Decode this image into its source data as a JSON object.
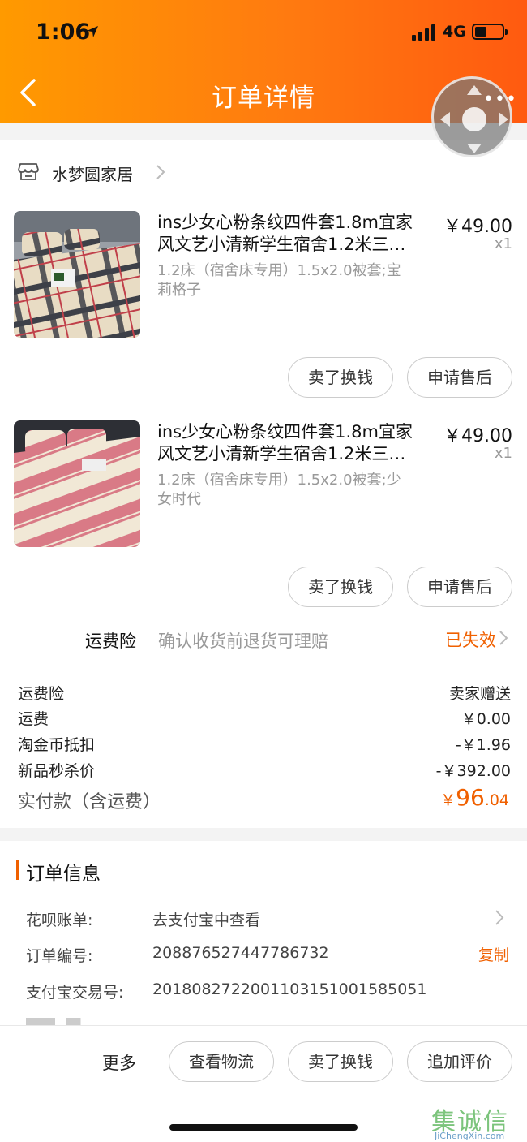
{
  "status_bar": {
    "time": "1:06",
    "network": "4G"
  },
  "nav": {
    "title": "订单详情",
    "more": "•••"
  },
  "shop": {
    "name": "水梦圆家居"
  },
  "items": [
    {
      "title_line1": "ins少女心粉条纹四件套1.8m宜家",
      "title_line2": "风文艺小清新学生宿舍1.2米三…",
      "sku_line1": "1.2床（宿舍床专用）1.5x2.0被套;宝",
      "sku_line2": "莉格子",
      "price": "￥49.00",
      "qty": "x1",
      "btn_sell": "卖了换钱",
      "btn_service": "申请售后"
    },
    {
      "title_line1": "ins少女心粉条纹四件套1.8m宜家",
      "title_line2": "风文艺小清新学生宿舍1.2米三…",
      "sku_line1": "1.2床（宿舍床专用）1.5x2.0被套;少",
      "sku_line2": "女时代",
      "price": "￥49.00",
      "qty": "x1",
      "btn_sell": "卖了换钱",
      "btn_service": "申请售后"
    }
  ],
  "insurance": {
    "label": "运费险",
    "desc": "确认收货前退货可理赔",
    "status": "已失效"
  },
  "fees": [
    {
      "key": "运费险",
      "value": "卖家赠送"
    },
    {
      "key": "运费",
      "value": "￥0.00"
    },
    {
      "key": "淘金币抵扣",
      "value": "-￥1.96"
    },
    {
      "key": "新品秒杀价",
      "value": "-￥392.00"
    }
  ],
  "paid": {
    "label": "实付款（含运费）",
    "currency": "￥",
    "integer": "96",
    "decimal": ".04"
  },
  "order_info": {
    "title": "订单信息",
    "rows": [
      {
        "key": "花呗账单:",
        "value": "去支付宝中查看"
      },
      {
        "key": "订单编号:",
        "value": "208876527447786732",
        "action": "复制"
      },
      {
        "key": "支付宝交易号:",
        "value": "2018082722001103151001585051"
      }
    ]
  },
  "bottom_bar": {
    "more": "更多",
    "buttons": [
      "查看物流",
      "卖了换钱",
      "追加评价"
    ]
  },
  "watermark": {
    "chars": "集诚信",
    "url": "JiChengXin.com"
  },
  "colors": {
    "accent": "#f06000",
    "header_start": "#ff9a00",
    "header_end": "#ff5a10"
  },
  "icons": [
    "location-arrow-icon",
    "signal-icon",
    "battery-icon",
    "back-arrow-icon",
    "float-control-icon",
    "shop-icon",
    "chevron-right-icon"
  ]
}
